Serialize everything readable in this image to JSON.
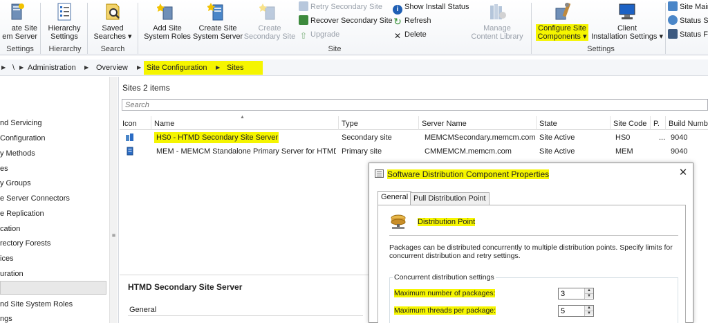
{
  "ribbon": {
    "buttons": {
      "create_site_system_server": "ate Site\nem Server",
      "hierarchy_settings": "Hierarchy\nSettings",
      "saved_searches": "Saved\nSearches ▾",
      "add_site_system_roles": "Add Site\nSystem Roles",
      "create_site_system_server_2": "Create Site\nSystem Server",
      "create_secondary_site": "Create\nSecondary Site",
      "manage_content_library": "Manage\nContent Library",
      "configure_site_components": "Configure Site\nComponents ▾",
      "client_installation_settings": "Client\nInstallation Settings ▾"
    },
    "small": {
      "retry_secondary_site": "Retry Secondary Site",
      "recover_secondary_site": "Recover Secondary Site",
      "upgrade": "Upgrade",
      "show_install_status": "Show Install Status",
      "refresh": "Refresh",
      "delete": "Delete",
      "site_maintenance": "Site Main",
      "status_summarizers": "Status Su",
      "status_filter": "Status Fil"
    },
    "groups": {
      "hierarchy": "Hierarchy",
      "settings_left": "Settings",
      "search": "Search",
      "site": "Site",
      "settings_right": "Settings"
    }
  },
  "breadcrumb": {
    "root": "\\",
    "items": [
      "Administration",
      "Overview",
      "Site Configuration",
      "Sites"
    ]
  },
  "nav": {
    "items": [
      "nd Servicing",
      "Configuration",
      "y Methods",
      "es",
      "y Groups",
      "e Server Connectors",
      "e Replication",
      "cation",
      "rectory Forests",
      "ices",
      "uration",
      "",
      "nd Site System Roles",
      "ngs"
    ]
  },
  "main": {
    "header_label": "Sites",
    "header_count": "2 items",
    "search_placeholder": "Search",
    "columns": [
      "Icon",
      "Name",
      "Type",
      "Server Name",
      "State",
      "Site Code",
      "P.",
      "Build Numb"
    ],
    "rows": [
      {
        "name": "HS0 - HTMD Secondary Site Server",
        "type": "Secondary site",
        "server": "MEMCMSecondary.memcm.com",
        "state": "Site Active",
        "code": "HS0",
        "p": "...",
        "build": "9040"
      },
      {
        "name": "MEM - MEMCM Standalone Primary Server for HTMD",
        "type": "Primary site",
        "server": "CMMEMCM.memcm.com",
        "state": "Site Active",
        "code": "MEM",
        "p": "",
        "build": "9040"
      }
    ],
    "detail_title": "HTMD Secondary Site Server",
    "detail_tab": "General"
  },
  "dialog": {
    "title": "Software Distribution Component Properties",
    "close": "✕",
    "tabs": [
      "General",
      "Pull Distribution Point"
    ],
    "section_title": "Distribution Point",
    "description": "Packages can be distributed concurrently to multiple distribution points. Specify limits for concurrent distribution and retry settings.",
    "group_label": "Concurrent distribution settings",
    "max_packages_label": "Maximum number of packages:",
    "max_packages_value": "3",
    "max_threads_label": "Maximum threads per package:",
    "max_threads_value": "5"
  },
  "colors": {
    "highlight": "#f5f500",
    "accent_blue": "#2b6cc4"
  }
}
